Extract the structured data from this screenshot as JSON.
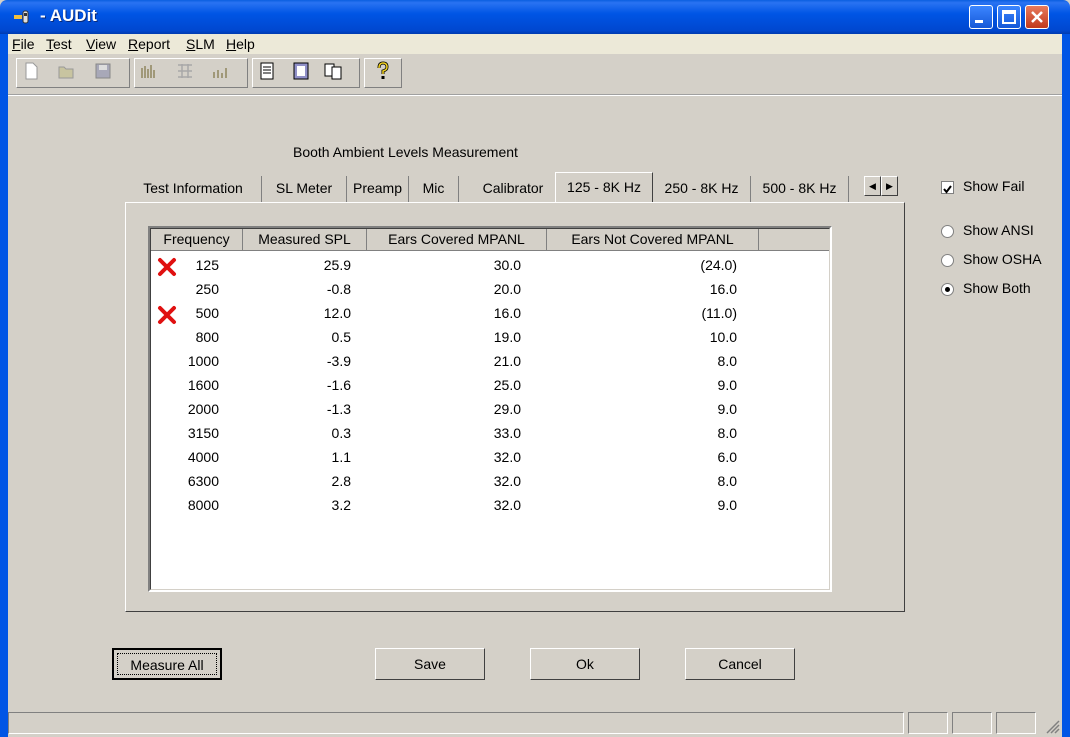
{
  "window": {
    "title": "- AUDit"
  },
  "menu": [
    "File",
    "Test",
    "View",
    "Report",
    "SLM",
    "Help"
  ],
  "toolbar": {
    "buttons": [
      "new-icon",
      "open-icon",
      "save-icon",
      "bars-icon",
      "grid-icon",
      "chart-icon",
      "page-icon",
      "report-icon",
      "copy-icon",
      "help-icon"
    ]
  },
  "heading": "Booth Ambient Levels Measurement",
  "tabs": [
    "Test Information",
    "SL Meter",
    "Preamp",
    "Mic",
    "Calibrator",
    "125 - 8K Hz",
    "250 - 8K Hz",
    "500 - 8K Hz"
  ],
  "active_tab": "125 - 8K Hz",
  "table": {
    "columns": [
      "Frequency",
      "Measured SPL",
      "Ears Covered MPANL",
      "Ears Not Covered MPANL"
    ],
    "rows": [
      {
        "fail": true,
        "freq": "125",
        "spl": "25.9",
        "covered": "30.0",
        "not_covered": "(24.0)"
      },
      {
        "fail": false,
        "freq": "250",
        "spl": "-0.8",
        "covered": "20.0",
        "not_covered": "16.0"
      },
      {
        "fail": true,
        "freq": "500",
        "spl": "12.0",
        "covered": "16.0",
        "not_covered": "(11.0)"
      },
      {
        "fail": false,
        "freq": "800",
        "spl": "0.5",
        "covered": "19.0",
        "not_covered": "10.0"
      },
      {
        "fail": false,
        "freq": "1000",
        "spl": "-3.9",
        "covered": "21.0",
        "not_covered": "8.0"
      },
      {
        "fail": false,
        "freq": "1600",
        "spl": "-1.6",
        "covered": "25.0",
        "not_covered": "9.0"
      },
      {
        "fail": false,
        "freq": "2000",
        "spl": "-1.3",
        "covered": "29.0",
        "not_covered": "9.0"
      },
      {
        "fail": false,
        "freq": "3150",
        "spl": "0.3",
        "covered": "33.0",
        "not_covered": "8.0"
      },
      {
        "fail": false,
        "freq": "4000",
        "spl": "1.1",
        "covered": "32.0",
        "not_covered": "6.0"
      },
      {
        "fail": false,
        "freq": "6300",
        "spl": "2.8",
        "covered": "32.0",
        "not_covered": "8.0"
      },
      {
        "fail": false,
        "freq": "8000",
        "spl": "3.2",
        "covered": "32.0",
        "not_covered": "9.0"
      }
    ]
  },
  "options": {
    "show_fail": {
      "label": "Show Fail",
      "checked": true
    },
    "radios": [
      {
        "label": "Show ANSI",
        "selected": false
      },
      {
        "label": "Show OSHA",
        "selected": false
      },
      {
        "label": "Show Both",
        "selected": true
      }
    ]
  },
  "buttons": {
    "measure_all": "Measure All",
    "save": "Save",
    "ok": "Ok",
    "cancel": "Cancel"
  },
  "colors": {
    "title_bar": "#0055e5",
    "fail_mark": "#e01010",
    "dialog_bg": "#d4d0c8"
  }
}
